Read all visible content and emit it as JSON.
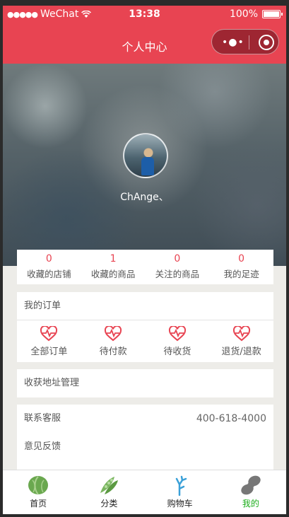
{
  "status_bar": {
    "carrier": "WeChat",
    "time": "13:38",
    "battery": "100%"
  },
  "title_bar": {
    "title": "个人中心"
  },
  "profile": {
    "username": "ChAnge、"
  },
  "stats": [
    {
      "count": "0",
      "label": "收藏的店铺"
    },
    {
      "count": "1",
      "label": "收藏的商品"
    },
    {
      "count": "0",
      "label": "关注的商品"
    },
    {
      "count": "0",
      "label": "我的足迹"
    }
  ],
  "orders": {
    "title": "我的订单",
    "items": [
      {
        "label": "全部订单",
        "icon": "heartbeat-icon"
      },
      {
        "label": "待付款",
        "icon": "heartbeat-icon"
      },
      {
        "label": "待收货",
        "icon": "heartbeat-icon"
      },
      {
        "label": "退货/退款",
        "icon": "heartbeat-icon"
      }
    ]
  },
  "address": {
    "label": "收获地址管理"
  },
  "service": {
    "contact_label": "联系客服",
    "phone": "400-618-4000",
    "feedback_label": "意见反馈"
  },
  "tabbar": {
    "items": [
      {
        "label": "首页",
        "icon": "cabbage-icon"
      },
      {
        "label": "分类",
        "icon": "peapod-icon"
      },
      {
        "label": "购物车",
        "icon": "branch-icon"
      },
      {
        "label": "我的",
        "icon": "peanut-icon"
      }
    ],
    "active_index": 3,
    "active_color": "#1aad19"
  },
  "colors": {
    "accent": "#e84452",
    "background": "#edece8"
  }
}
